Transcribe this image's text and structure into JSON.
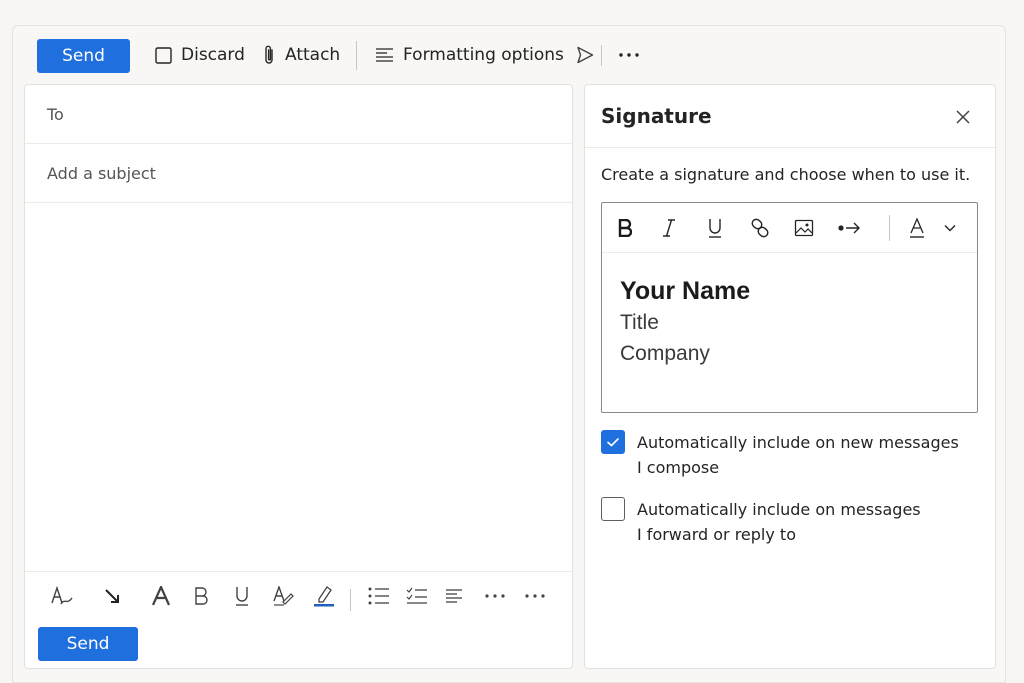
{
  "toolbar": {
    "send_label": "Send",
    "discard_label": "Discard",
    "attach_label": "Attach",
    "formatting_label": "Formatting options"
  },
  "compose": {
    "to_label": "To",
    "subject_placeholder": "Add a subject",
    "send_label": "Send"
  },
  "signature": {
    "title": "Signature",
    "description": "Create a signature and choose when to use it.",
    "content": {
      "name": "Your Name",
      "title": "Title",
      "company": "Company"
    },
    "options": [
      {
        "line1": "Automatically include on new messages",
        "line2": "I compose",
        "checked": true
      },
      {
        "line1": "Automatically include on messages",
        "line2": "I forward or reply to",
        "checked": false
      }
    ]
  },
  "colors": {
    "accent": "#1f6fdf",
    "highlight_underline": "#1f5fbf"
  },
  "icons": [
    "discard-checkbox-icon",
    "paperclip-icon",
    "formatting-lines-icon",
    "send-arrow-icon",
    "more-icon",
    "close-icon",
    "bold-icon",
    "italic-icon",
    "underline-icon",
    "link-icon",
    "image-icon",
    "arrow-link-icon",
    "font-color-icon",
    "chevron-down-icon",
    "format-painter-icon",
    "clear-format-icon",
    "font-size-icon",
    "highlight-icon",
    "bullet-list-icon",
    "checklist-icon",
    "align-icon",
    "check-icon"
  ]
}
